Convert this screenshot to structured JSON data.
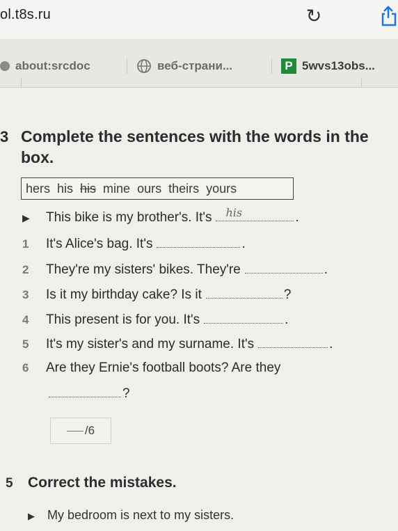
{
  "browser": {
    "url": "ol.t8s.ru",
    "reload_glyph": "↻",
    "tabs": [
      {
        "label": "about:srcdoc",
        "icon": "dot-icon"
      },
      {
        "label": "веб-страни...",
        "icon": "globe-icon"
      },
      {
        "label": "5wvs13obs...",
        "icon": "p-favicon",
        "favicon_text": "P"
      }
    ],
    "colors": {
      "share": "#1a73e8",
      "favicon_bg": "#1f8a3a"
    }
  },
  "exercise": {
    "number": "3",
    "title": "Complete the sentences with the words in the box.",
    "word_box": [
      {
        "word": "hers",
        "struck": false
      },
      {
        "word": "his",
        "struck": false
      },
      {
        "word": "his",
        "struck": true
      },
      {
        "word": "mine",
        "struck": false
      },
      {
        "word": "ours",
        "struck": false
      },
      {
        "word": "theirs",
        "struck": false
      },
      {
        "word": "yours",
        "struck": false
      }
    ],
    "example": {
      "marker": "▶",
      "text": "This bike is my brother's. It's",
      "answer": "his",
      "trail": "."
    },
    "items": [
      {
        "num": "1",
        "text": "It's Alice's bag. It's",
        "trail": "."
      },
      {
        "num": "2",
        "text": "They're my sisters' bikes. They're",
        "trail": "."
      },
      {
        "num": "3",
        "text": "Is it my birthday cake? Is it",
        "trail": "?"
      },
      {
        "num": "4",
        "text": "This present is for you. It's",
        "trail": "."
      },
      {
        "num": "5",
        "text": "It's my sister's and my surname. It's",
        "trail": "."
      },
      {
        "num": "6",
        "text": "Are they Ernie's football boots? Are they",
        "trail": ""
      }
    ],
    "item6_trail": "?",
    "score": "/6"
  },
  "section5": {
    "number": "5",
    "title": "Correct the mistakes.",
    "example_marker": "▶",
    "example_text": "My bedroom is next to my sisters."
  }
}
